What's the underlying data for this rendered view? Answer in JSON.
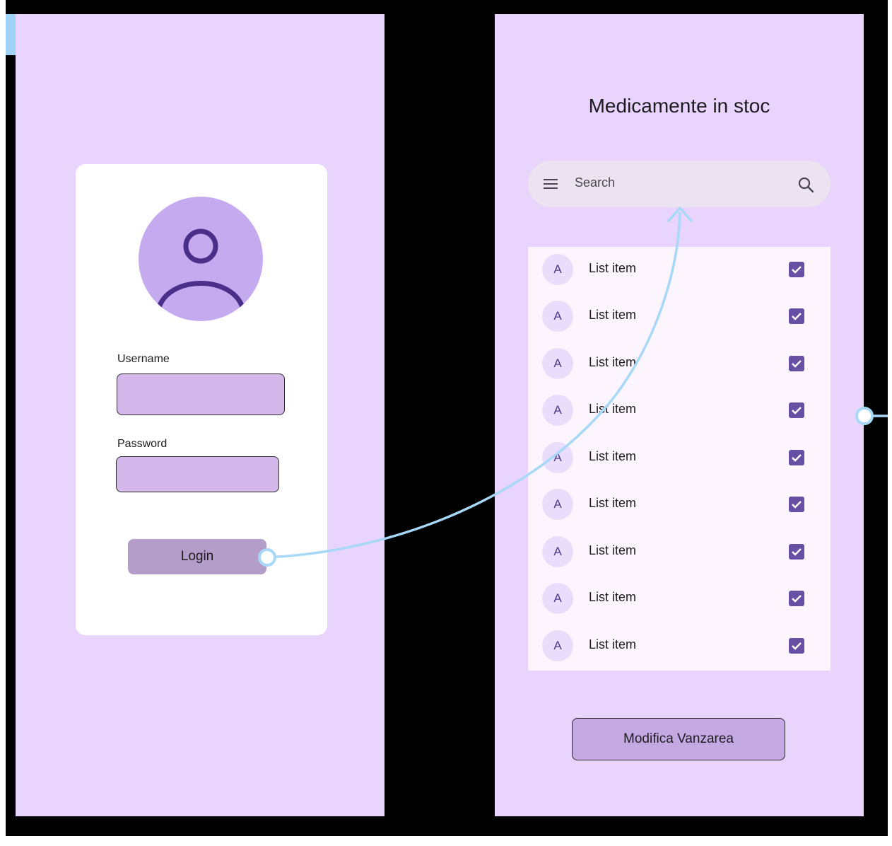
{
  "login_screen": {
    "username_label": "Username",
    "username_value": "",
    "password_label": "Password",
    "password_value": "",
    "login_button": "Login"
  },
  "stock_screen": {
    "title": "Medicamente in stoc",
    "search": {
      "placeholder": "Search",
      "menu_icon": "menu-icon",
      "search_icon": "search-icon"
    },
    "list": [
      {
        "avatar": "A",
        "label": "List item",
        "checked": true
      },
      {
        "avatar": "A",
        "label": "List item",
        "checked": true
      },
      {
        "avatar": "A",
        "label": "List item",
        "checked": true
      },
      {
        "avatar": "A",
        "label": "List item",
        "checked": true
      },
      {
        "avatar": "A",
        "label": "List item",
        "checked": true
      },
      {
        "avatar": "A",
        "label": "List item",
        "checked": true
      },
      {
        "avatar": "A",
        "label": "List item",
        "checked": true
      },
      {
        "avatar": "A",
        "label": "List item",
        "checked": true
      },
      {
        "avatar": "A",
        "label": "List item",
        "checked": true
      }
    ],
    "action_button": "Modifica Vanzarea"
  },
  "colors": {
    "canvas": "#000000",
    "frame_bg": "#e9d4fd",
    "accent": "#6750a4",
    "connector": "#a8d8f8"
  }
}
